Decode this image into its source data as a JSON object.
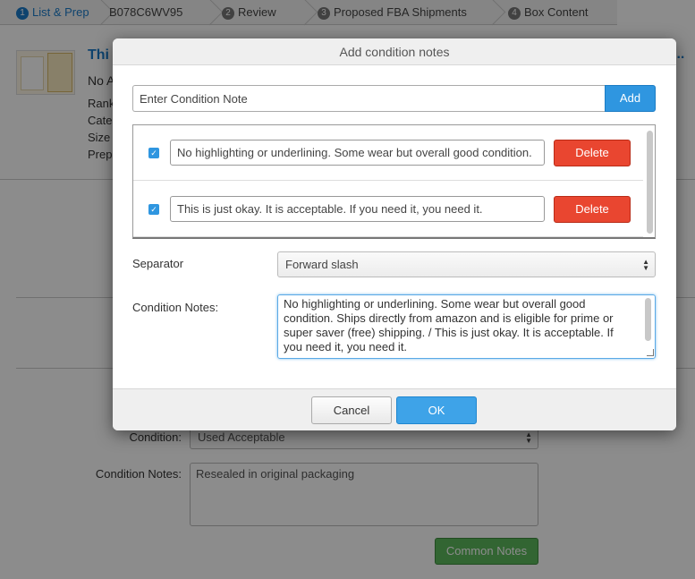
{
  "breadcrumbs": [
    {
      "num": "1",
      "label": "List & Prep"
    },
    {
      "num": "",
      "label": "B078C6WV95"
    },
    {
      "num": "2",
      "label": "Review"
    },
    {
      "num": "3",
      "label": "Proposed FBA Shipments"
    },
    {
      "num": "4",
      "label": "Box Content"
    }
  ],
  "product": {
    "title_fragment": "Thi",
    "title_ellipsis": "...",
    "line1": "No A",
    "line2": "Rank",
    "line3": "Cate",
    "line4": "Size T",
    "line5": "Prep"
  },
  "background_form": {
    "condition_label": "Condition:",
    "condition_value": "Used Acceptable",
    "notes_label": "Condition Notes:",
    "notes_value": "Resealed in original packaging",
    "common_notes_button": "Common Notes"
  },
  "modal": {
    "title": "Add condition notes",
    "input_placeholder": "Enter Condition Note",
    "add_button": "Add",
    "notes": [
      {
        "checked": true,
        "text": "No highlighting or underlining. Some wear but overall good condition.",
        "delete_label": "Delete"
      },
      {
        "checked": true,
        "text": "This is just okay. It is acceptable. If you need it, you need it.",
        "delete_label": "Delete"
      }
    ],
    "separator_label": "Separator",
    "separator_value": "Forward slash",
    "condition_notes_label": "Condition Notes:",
    "condition_notes_value": "No highlighting or underlining. Some wear but overall good condition. Ships directly from amazon and is eligible for prime or super saver (free) shipping. / This is just okay. It is acceptable. If you need it, you need it.",
    "cancel_button": "Cancel",
    "ok_button": "OK"
  },
  "colors": {
    "accent_blue": "#2f96e0",
    "delete_red": "#e94630",
    "common_notes_green": "#5cb85c"
  }
}
